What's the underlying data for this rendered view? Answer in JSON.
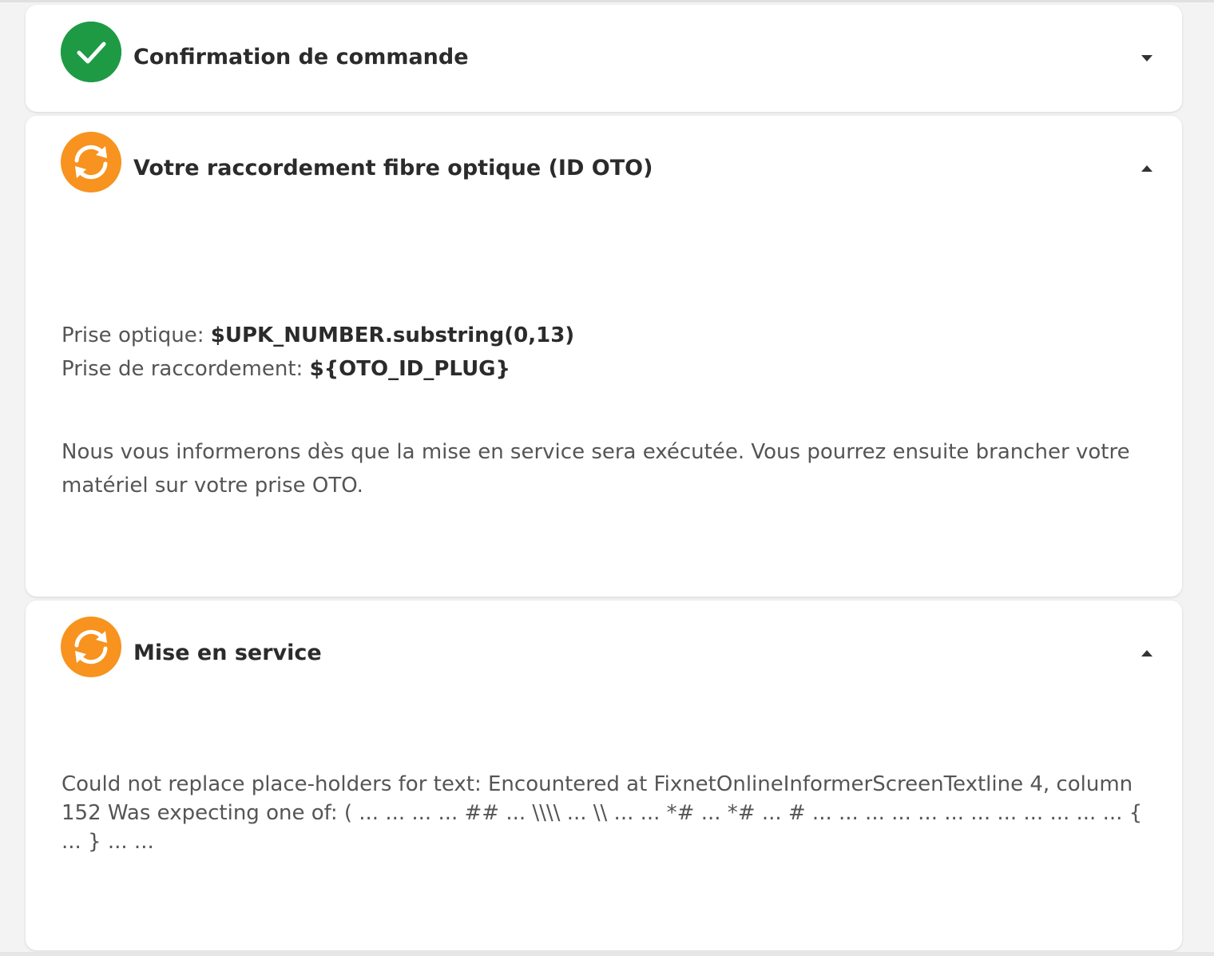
{
  "colors": {
    "success": "#1e9a45",
    "pending": "#f7931e"
  },
  "sections": [
    {
      "title": "Confirmation de commande",
      "status_icon": "check-icon",
      "status": "done",
      "chevron": "chevron-down-icon"
    },
    {
      "title": "Votre raccordement fibre optique (ID OTO)",
      "status_icon": "sync-icon",
      "status": "in-progress",
      "chevron": "chevron-up-icon",
      "prise_optique_label": "Prise optique: ",
      "prise_optique_value": "$UPK_NUMBER.substring(0,13)",
      "prise_raccordement_label": "Prise de raccordement: ",
      "prise_raccordement_value": "${OTO_ID_PLUG}",
      "info_text": "Nous vous informerons dès que la mise en service sera exécutée. Vous pourrez ensuite brancher votre matériel sur votre prise OTO."
    },
    {
      "title": "Mise en service",
      "status_icon": "sync-icon",
      "status": "in-progress",
      "chevron": "chevron-up-icon",
      "error_text": "Could not replace place-holders for text: Encountered at FixnetOnlineInformerScreenTextline 4, column 152 Was expecting one of: ( ... ... ... ... ## ... \\\\\\\\ ... \\\\ ... ... *# ... *# ... # ... ... ... ... ... ... ... ... ... ... ... ... { ... } ... ..."
    }
  ]
}
